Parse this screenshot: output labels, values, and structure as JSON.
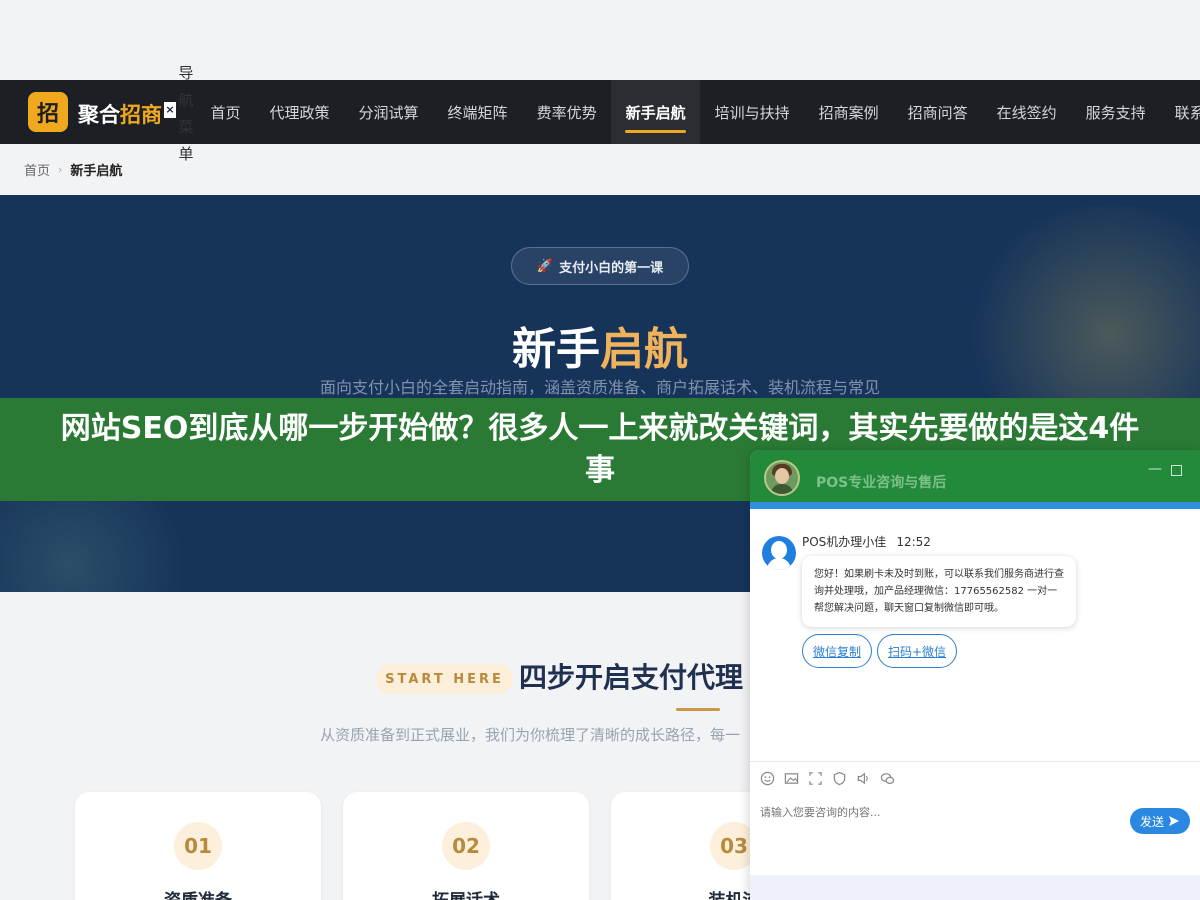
{
  "nav": {
    "logo_char": "招",
    "brand_main": "聚合",
    "brand_accent": "招商",
    "close_glyph": "×",
    "menu_label": [
      "导",
      "航",
      "菜",
      "单"
    ],
    "items": [
      "首页",
      "代理政策",
      "分润试算",
      "终端矩阵",
      "费率优势",
      "新手启航",
      "培训与扶持",
      "招商案例",
      "招商问答",
      "在线签约",
      "服务支持",
      "联系"
    ],
    "active_index": 5
  },
  "breadcrumb": {
    "home": "首页",
    "separator": "›",
    "current": "新手启航"
  },
  "hero": {
    "badge_icon": "🚀",
    "badge_text": "支付小白的第一课",
    "title_main": "新手",
    "title_accent": "启航",
    "subtitle": "面向支付小白的全套启动指南，涵盖资质准备、商户拓展话术、装机流程与常见"
  },
  "banner": {
    "text": "网站SEO到底从哪一步开始做？很多人一上来就改关键词，其实先要做的是这4件事"
  },
  "section": {
    "tag": "START HERE",
    "title": "四步开启支付代理",
    "subtitle": "从资质准备到正式展业，我们为你梳理了清晰的成长路径，每一"
  },
  "cards": [
    {
      "num": "01",
      "title": "资质准备"
    },
    {
      "num": "02",
      "title": "拓展话术"
    },
    {
      "num": "03",
      "title": "装机流"
    }
  ],
  "chat": {
    "title": "POS专业咨询与售后",
    "min_glyph": "—",
    "agent_name": "POS机办理小佳",
    "time": "12:52",
    "message": "您好！如果刷卡未及时到账，可以联系我们服务商进行查询并处理哦，加产品经理微信：17765562582 一对一帮您解决问题，聊天窗口复制微信即可哦。",
    "buttons": [
      "微信复制",
      "扫码+微信"
    ],
    "toolbar_icons": [
      "emoji-icon",
      "image-icon",
      "screenshot-icon",
      "shield-icon",
      "sound-icon",
      "wechat-icon"
    ],
    "input_placeholder": "请输入您要咨询的内容...",
    "send_label": "发送",
    "colors": {
      "header": "#228a3a",
      "accent": "#2b88e0"
    }
  }
}
